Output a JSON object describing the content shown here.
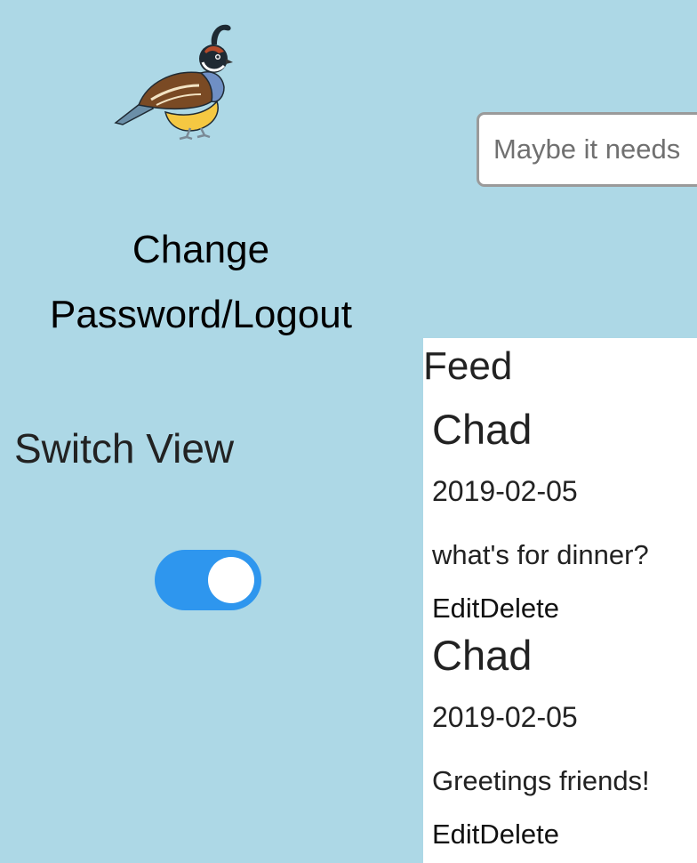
{
  "header": {
    "logo_icon": "quail-icon"
  },
  "composer": {
    "placeholder": "Maybe it needs"
  },
  "sidebar": {
    "account_link": "Change Password/Logout",
    "switch_view_label": "Switch View",
    "toggle_on": true,
    "toggle_color": "#2e96ee"
  },
  "feed": {
    "title": "Feed",
    "posts": [
      {
        "author": "Chad",
        "date": "2019-02-05",
        "text": "what's for dinner?",
        "edit_label": "Edit",
        "delete_label": "Delete"
      },
      {
        "author": "Chad",
        "date": "2019-02-05",
        "text": "Greetings friends!",
        "edit_label": "Edit",
        "delete_label": "Delete"
      }
    ]
  },
  "colors": {
    "background": "#add8e6",
    "feed_background": "#ffffff"
  }
}
